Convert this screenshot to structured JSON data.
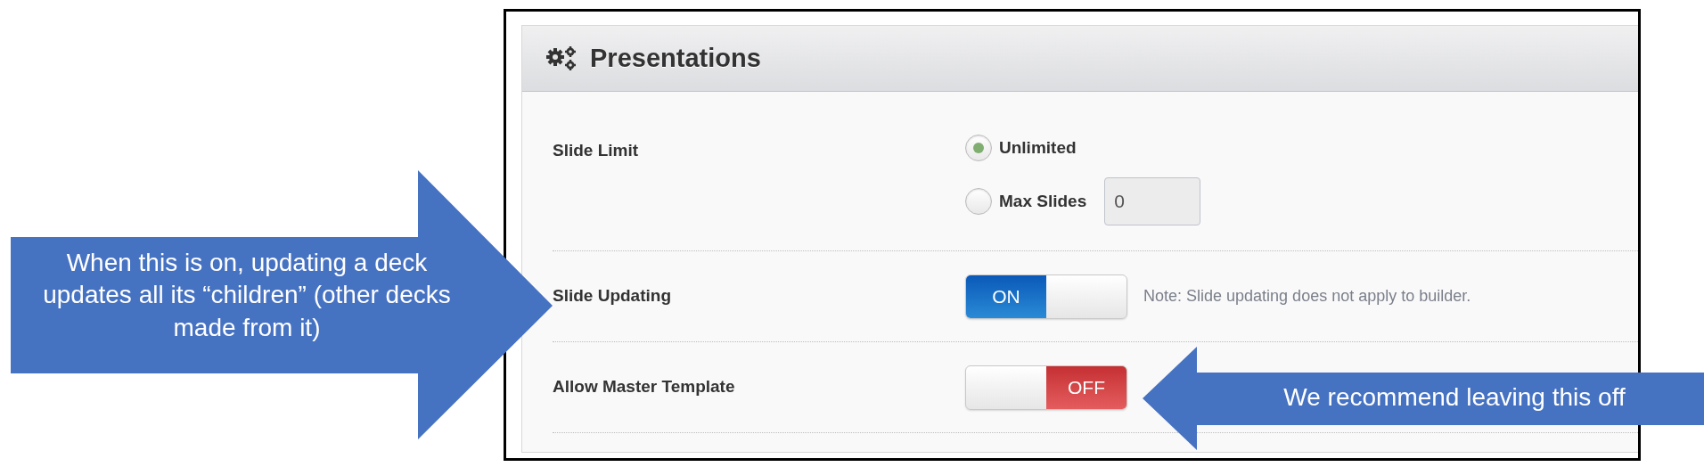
{
  "panel": {
    "title": "Presentations"
  },
  "settings": [
    {
      "kind": "radio_group",
      "label": "Slide Limit",
      "options": [
        {
          "label": "Unlimited",
          "selected": true
        },
        {
          "label": "Max Slides",
          "selected": false,
          "value": "0"
        }
      ]
    },
    {
      "kind": "toggle",
      "label": "Slide Updating",
      "on": true,
      "on_text": "ON",
      "note": "Note: Slide updating does not apply to builder."
    },
    {
      "kind": "toggle",
      "label": "Allow Master Template",
      "on": false,
      "off_text": "OFF"
    }
  ],
  "callouts": [
    {
      "kind": "right_arrow",
      "text": "When this is on, updating a deck updates all its “children” (other decks made from it)"
    },
    {
      "kind": "left_arrow",
      "text": "We recommend leaving this off"
    }
  ]
}
